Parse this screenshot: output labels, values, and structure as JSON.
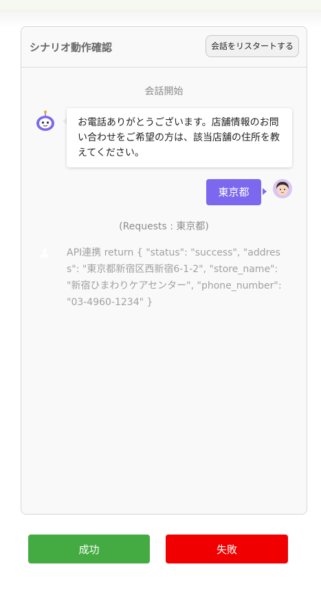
{
  "panel": {
    "title": "シナリオ動作確認",
    "restart_label": "会話をリスタートする"
  },
  "chat": {
    "start_label": "会話開始",
    "bot_message": "お電話ありがとうございます。店舗情報のお問い合わせをご希望の方は、該当店舗の住所を教えてください。",
    "user_message": "東京都",
    "requests_label": "(Requests : 東京都)",
    "api_message": "API連携 return { \"status\": \"success\", \"address\": \"東京都新宿区西新宿6-1-2\", \"store_name\": \"新宿ひまわりケアセンター\", \"phone_number\": \"03-4960-1234\" }"
  },
  "actions": {
    "success_label": "成功",
    "fail_label": "失敗"
  },
  "colors": {
    "accent": "#7b68ee",
    "success": "#44ab42",
    "fail": "#f00000"
  },
  "icons": {
    "bot": "robot-icon",
    "user": "user-avatar-icon",
    "system": "person-icon"
  }
}
